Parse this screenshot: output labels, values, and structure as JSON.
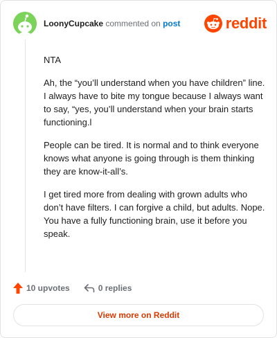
{
  "header": {
    "username": "LoonyCupcake",
    "action_text": " commented on ",
    "post_link": "post",
    "brand": "reddit",
    "avatar_icon": "snoo-avatar-icon",
    "brand_icon": "reddit-logo-icon",
    "colors": {
      "brand": "#ff4500",
      "avatar": "#7bd35a",
      "link": "#0079d3"
    }
  },
  "comment": {
    "paragraphs": [
      "NTA",
      "Ah, the “you’ll understand when you have children” line. I always have to bite my tongue because I always want to say, “yes, you’ll understand when your brain starts functioning.l",
      "People can be tired. It is normal and to think everyone knows what anyone is going through is them thinking they are know-it-all’s.",
      "I get tired more from dealing with grown adults who don’t have filters. I can forgive a child, but adults. Nope. You have a fully functioning brain, use it before you speak."
    ]
  },
  "actions": {
    "upvotes": "10 upvotes",
    "upvote_icon": "upvote-arrow-icon",
    "replies": "0 replies",
    "reply_icon": "reply-arrow-icon"
  },
  "footer": {
    "view_more": "View more on Reddit",
    "color": "#d93900"
  }
}
